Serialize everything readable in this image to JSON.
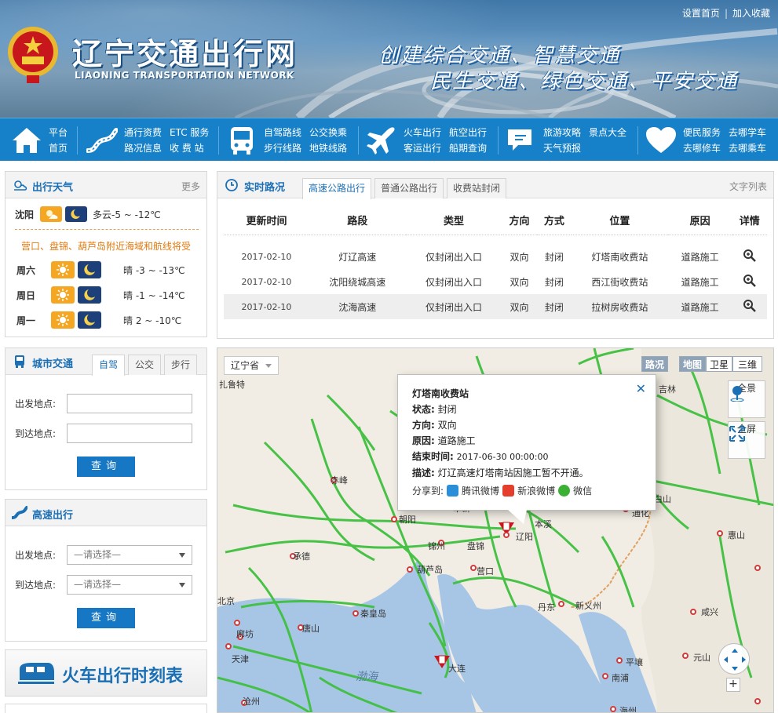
{
  "header": {
    "title_cn": "辽宁交通出行网",
    "title_en": "LIAONING TRANSPORTATION NETWORK",
    "slogan_line1": "创建综合交通、智慧交通",
    "slogan_line2": "民生交通、绿色交通、平安交通",
    "set_home": "设置首页",
    "separator": "|",
    "add_favorite": "加入收藏"
  },
  "nav": {
    "groups": [
      {
        "icon": "home-icon",
        "links": [
          "平台",
          "首页"
        ]
      },
      {
        "icon": "road-icon",
        "links": [
          "通行资费",
          "ETC 服务",
          "路况信息",
          "收 费 站"
        ]
      },
      {
        "icon": "bus-icon",
        "links": [
          "自驾路线",
          "公交换乘",
          "步行线路",
          "地铁线路"
        ]
      },
      {
        "icon": "plane-icon",
        "links": [
          "火车出行",
          "航空出行",
          "客运出行",
          "船期查询"
        ]
      },
      {
        "icon": "chat-icon",
        "links": [
          "旅游攻略",
          "景点大全",
          "天气预报"
        ]
      },
      {
        "icon": "heart-icon",
        "links": [
          "便民服务",
          "去哪学车",
          "去哪修车",
          "去哪乘车"
        ]
      }
    ]
  },
  "weather": {
    "title": "出行天气",
    "more": "更多",
    "city": "沈阳",
    "today_desc": "多云-5 ~ -12℃",
    "alert": "营口、盘锦、葫芦岛附近海域和航线将受",
    "days": [
      {
        "day": "周六",
        "desc": "晴 -3 ~ -13℃"
      },
      {
        "day": "周日",
        "desc": "晴 -1 ~ -14℃"
      },
      {
        "day": "周一",
        "desc": "晴 2 ~ -10℃"
      }
    ]
  },
  "realtime": {
    "title": "实时路况",
    "tabs": [
      "高速公路出行",
      "普通公路出行",
      "收费站封闭"
    ],
    "text_list": "文字列表",
    "columns": [
      "更新时间",
      "路段",
      "类型",
      "方向",
      "方式",
      "位置",
      "原因",
      "详情"
    ],
    "rows": [
      {
        "time": "2017-02-10",
        "road": "灯辽高速",
        "type": "仅封闭出入口",
        "direction": "双向",
        "mode": "封闭",
        "location": "灯塔南收费站",
        "reason": "道路施工"
      },
      {
        "time": "2017-02-10",
        "road": "沈阳绕城高速",
        "type": "仅封闭出入口",
        "direction": "双向",
        "mode": "封闭",
        "location": "西江街收费站",
        "reason": "道路施工"
      },
      {
        "time": "2017-02-10",
        "road": "沈海高速",
        "type": "仅封闭出入口",
        "direction": "双向",
        "mode": "封闭",
        "location": "拉树房收费站",
        "reason": "道路施工"
      }
    ]
  },
  "city_traffic": {
    "title": "城市交通",
    "tabs": [
      "自驾",
      "公交",
      "步行"
    ],
    "from_label": "出发地点:",
    "to_label": "到达地点:",
    "from_value": "",
    "to_value": "",
    "query": "查询"
  },
  "highway": {
    "title": "高速出行",
    "from_label": "出发地点:",
    "to_label": "到达地点:",
    "from_select": "—请选择—",
    "to_select": "—请选择—",
    "query": "查询"
  },
  "train": {
    "label": "火车出行时刻表"
  },
  "map": {
    "province": "辽宁省",
    "traffic_btn": "路况",
    "modes": [
      "地图",
      "卫星",
      "三维"
    ],
    "panorama": "全景",
    "fullscreen": "全屏",
    "zoom_in": "+",
    "labels": [
      {
        "text": "扎鲁特",
        "kind": "city"
      },
      {
        "text": "吉林",
        "kind": "city"
      },
      {
        "text": "赤峰",
        "kind": "city"
      },
      {
        "text": "朝阳",
        "kind": "city"
      },
      {
        "text": "阜新",
        "kind": "city"
      },
      {
        "text": "本溪",
        "kind": "city"
      },
      {
        "text": "辽阳",
        "kind": "city"
      },
      {
        "text": "锦州",
        "kind": "city"
      },
      {
        "text": "盘锦",
        "kind": "city"
      },
      {
        "text": "承德",
        "kind": "city"
      },
      {
        "text": "葫芦岛",
        "kind": "city"
      },
      {
        "text": "营口",
        "kind": "city"
      },
      {
        "text": "通化",
        "kind": "city"
      },
      {
        "text": "白山",
        "kind": "city"
      },
      {
        "text": "惠山",
        "kind": "city"
      },
      {
        "text": "丹东",
        "kind": "city"
      },
      {
        "text": "新义州",
        "kind": "city"
      },
      {
        "text": "咸兴",
        "kind": "city"
      },
      {
        "text": "北京",
        "kind": "city"
      },
      {
        "text": "秦皇岛",
        "kind": "city"
      },
      {
        "text": "唐山",
        "kind": "city"
      },
      {
        "text": "廊坊",
        "kind": "city"
      },
      {
        "text": "天津",
        "kind": "city"
      },
      {
        "text": "大连",
        "kind": "city"
      },
      {
        "text": "平壤",
        "kind": "city"
      },
      {
        "text": "元山",
        "kind": "city"
      },
      {
        "text": "南浦",
        "kind": "city"
      },
      {
        "text": "沧州",
        "kind": "city"
      },
      {
        "text": "海州",
        "kind": "city"
      },
      {
        "text": "渤海",
        "kind": "sea"
      }
    ],
    "popup": {
      "title": "灯塔南收费站",
      "status_label": "状态:",
      "status": "封闭",
      "direction_label": "方向:",
      "direction": "双向",
      "reason_label": "原因:",
      "reason": "道路施工",
      "end_label": "结束时间:",
      "end": "2017-06-30 00:00:00",
      "desc_label": "描述:",
      "desc": "灯辽高速灯塔南站因施工暂不开通。",
      "share_label": "分享到:",
      "share_tencent": "腾讯微博",
      "share_sina": "新浪微博",
      "share_wechat": "微信",
      "close": "✕"
    }
  }
}
